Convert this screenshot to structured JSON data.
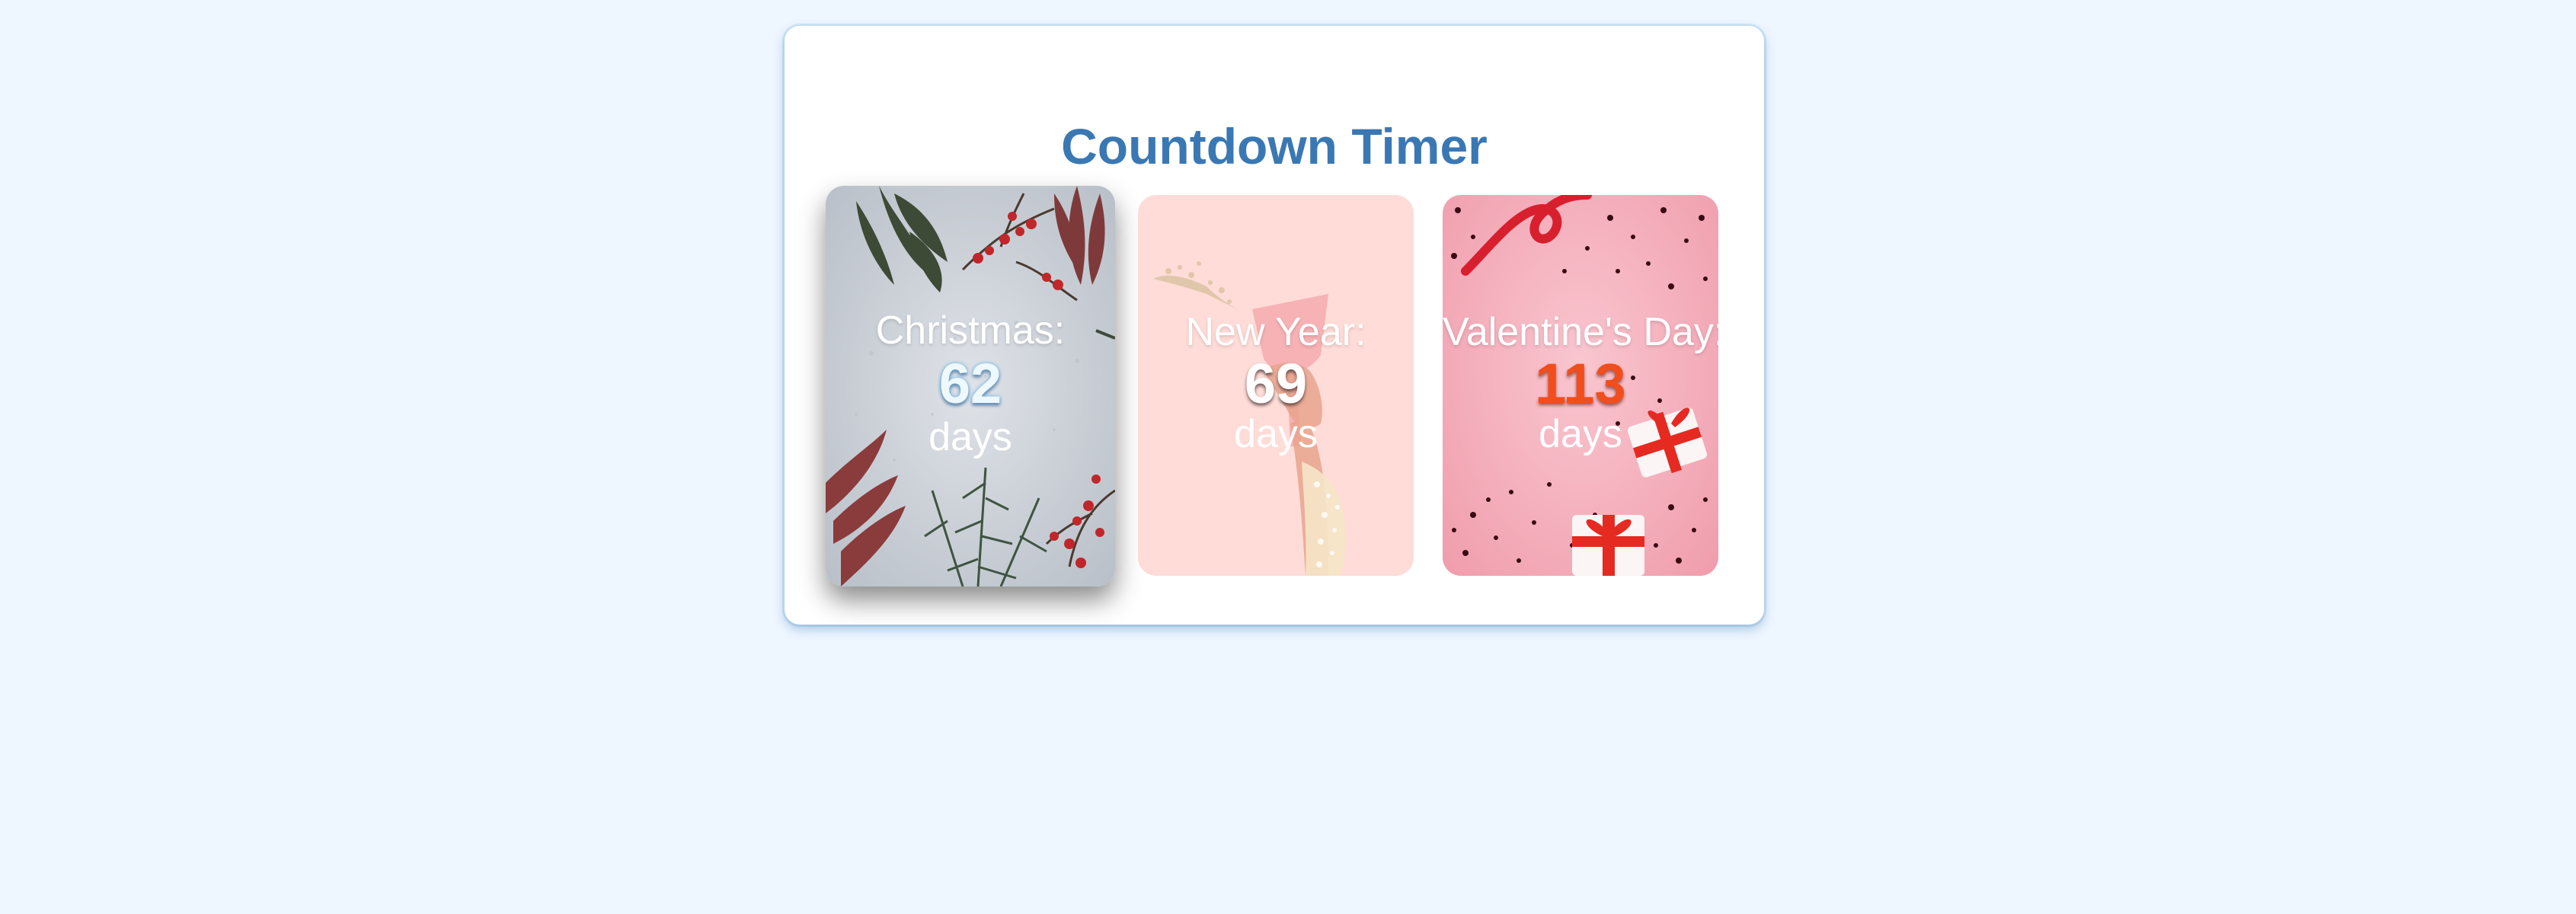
{
  "page": {
    "background_color": "#eef6ff",
    "panel_color": "#ffffff",
    "title_color": "#3a78b4"
  },
  "header": {
    "title": "Countdown Timer"
  },
  "cards": [
    {
      "label": "Christmas:",
      "days": "62",
      "unit": "days",
      "number_color": "#eef8ff",
      "theme": "christmas-foliage-on-grey-stone"
    },
    {
      "label": "New Year:",
      "days": "69",
      "unit": "days",
      "number_color": "#ffffff",
      "theme": "champagne-glass-on-pink"
    },
    {
      "label": "Valentine's Day:",
      "days": "113",
      "unit": "days",
      "number_color": "#f04e1c",
      "theme": "gift-boxes-and-confetti-on-pink"
    }
  ]
}
